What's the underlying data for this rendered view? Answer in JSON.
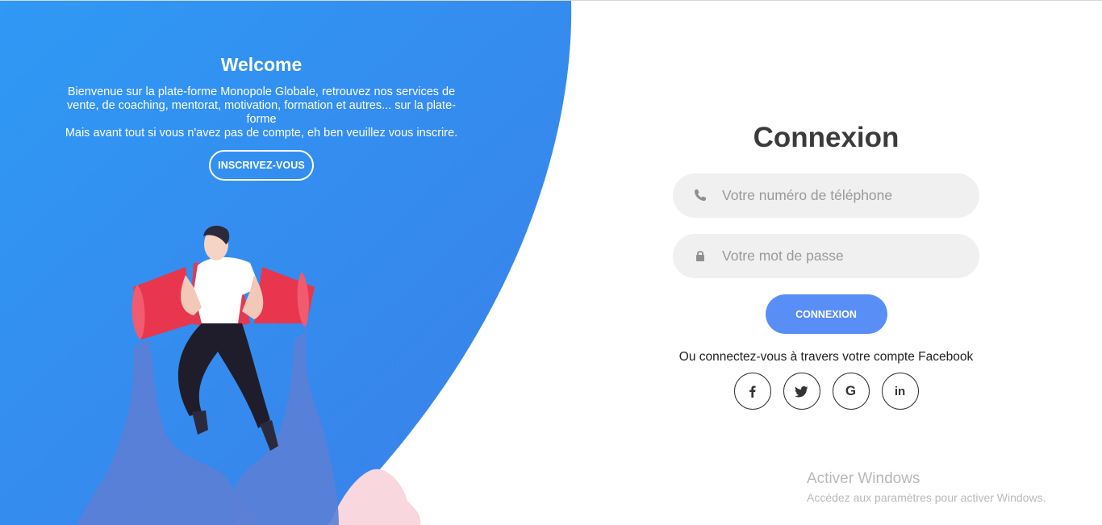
{
  "colors": {
    "blue_start": "#2f97f3",
    "blue_end": "#3b82ec",
    "button_blue": "#5a8ef7",
    "field_bg": "#f0f0f0",
    "title_dark": "#3b3b3b"
  },
  "hero": {
    "title": "Welcome",
    "line1": "Bienvenue sur la plate-forme Monopole Globale, retrouvez nos services de vente, de coaching, mentorat, motivation, formation et autres... sur la plate-forme",
    "line2": "Mais avant tout si vous n'avez pas de compte, eh ben veuillez vous inscrire.",
    "signup_label": "INSCRIVEZ-VOUS",
    "illustration_icon": "jetpack-man-illustration"
  },
  "login": {
    "title": "Connexion",
    "phone_placeholder": "Votre numéro de téléphone",
    "phone_icon": "phone-icon",
    "password_placeholder": "Votre mot de passe",
    "password_icon": "lock-icon",
    "submit_label": "CONNEXION",
    "alt_text": "Ou connectez-vous à travers votre compte Facebook",
    "social": [
      {
        "icon": "facebook-icon",
        "glyph": "f"
      },
      {
        "icon": "twitter-icon",
        "glyph": ""
      },
      {
        "icon": "google-icon",
        "glyph": "G"
      },
      {
        "icon": "linkedin-icon",
        "glyph": "in"
      }
    ]
  },
  "watermark": {
    "title": "Activer Windows",
    "subtitle": "Accédez aux paramètres pour activer Windows."
  }
}
